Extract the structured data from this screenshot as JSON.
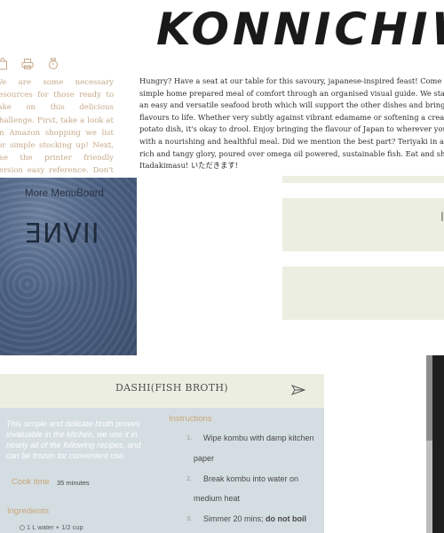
{
  "header": {
    "brand": "KONNICHIWA"
  },
  "toolbar": {
    "icons": [
      "bag-icon",
      "print-icon",
      "timer-icon"
    ]
  },
  "sidebar_text": "We are some necessary resources for those ready to take on this delicious challenge. First, take a look at an Amazon shopping we list for simple stocking up! Next, use the printer friendly version easy reference. Don't panic, we wouldn't leave you hanging! Click on the",
  "intro": {
    "lines": [
      "Hungry? Have a seat at our table for this savoury, japanese-inspired feast! Come taste",
      "simple home prepared meal of comfort through an organised visual guide. We start with",
      "an easy and versatile seafood broth which will support the other dishes and bring their",
      "flavours to life. Whether very subtly against vibrant edamame or softening a creamy onion",
      "potato dish, it's okay to drool. Enjoy bringing the flavour of Japan to wherever you are",
      "with a nourishing and healthful meal. Did we mention the best part? Teriyaki in all it's",
      "rich and tangy glory, poured over omega oil powered, sustainable fish. Eat and share.",
      "Itadakimasu! いただきます!"
    ]
  },
  "menu_card": {
    "title": "More MenuBoard",
    "glyph": "ƎИⅤII"
  },
  "panel_mark": "I",
  "recipe": {
    "title": "DASHI(FISH BROTH)",
    "blurb": "This simple and delicate broth proves invaluable in the kitchen, we use it in nearly all of the following recipes, and can be frozen for convenient use.",
    "cook_time_label": "Cook time",
    "cook_time_value": "35 minutes",
    "ingredients_label": "Ingredients",
    "ingredients": [
      "1 L water + 1/2 cup"
    ],
    "instructions_label": "Instructions",
    "steps": [
      {
        "num": "1.",
        "line1": "Wipe kombu with damp kitchen",
        "line2": "paper"
      },
      {
        "num": "2.",
        "line1": "Break kombu into water on",
        "line2": "medium heat"
      },
      {
        "num": "3.",
        "line1_plain": "Simmer 20 mins; ",
        "line1_bold": "do not boil"
      }
    ]
  }
}
